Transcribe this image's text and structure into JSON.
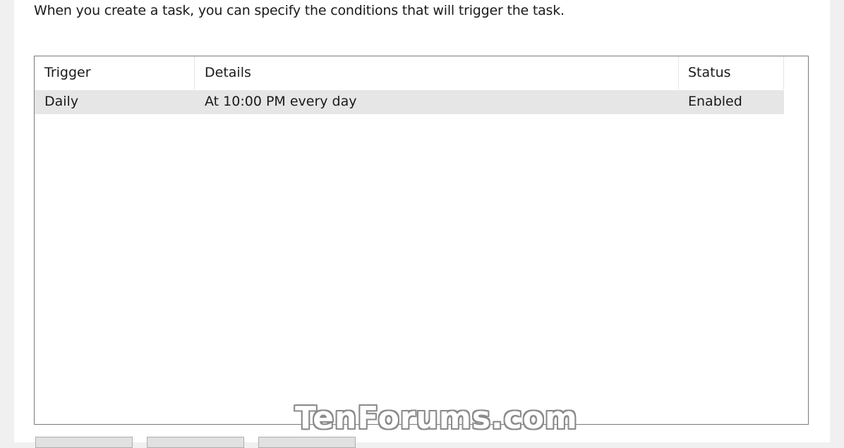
{
  "description": "When you create a task, you can specify the conditions that will trigger the task.",
  "triggers_table": {
    "columns": [
      "Trigger",
      "Details",
      "Status"
    ],
    "rows": [
      {
        "trigger": "Daily",
        "details": "At 10:00 PM every day",
        "status": "Enabled"
      }
    ]
  },
  "watermark": "TenForums.com"
}
